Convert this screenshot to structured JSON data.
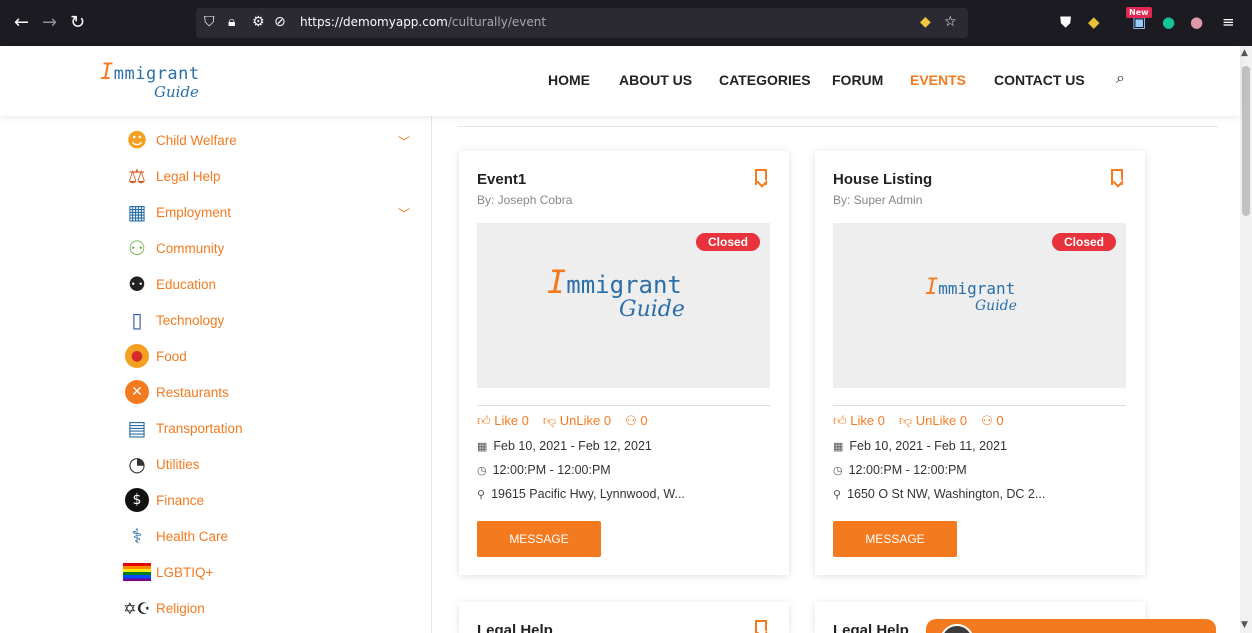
{
  "browser": {
    "url_host": "https://demomyapp.com",
    "url_path": "/culturally/event",
    "new_badge": "New"
  },
  "logo": {
    "initial": "I",
    "line1": "mmigrant",
    "line2": "Guide"
  },
  "nav": [
    {
      "label": "HOME",
      "active": false
    },
    {
      "label": "ABOUT US",
      "active": false
    },
    {
      "label": "CATEGORIES",
      "active": false
    },
    {
      "label": "FORUM",
      "active": false
    },
    {
      "label": "EVENTS",
      "active": true
    },
    {
      "label": "CONTACT US",
      "active": false
    }
  ],
  "sidebar": {
    "categories": [
      {
        "label": "Child Welfare",
        "icon": "child-icon",
        "expandable": true
      },
      {
        "label": "Legal Help",
        "icon": "scales-icon",
        "expandable": false
      },
      {
        "label": "Employment",
        "icon": "employment-icon",
        "expandable": true
      },
      {
        "label": "Community",
        "icon": "community-icon",
        "expandable": false
      },
      {
        "label": "Education",
        "icon": "education-icon",
        "expandable": false
      },
      {
        "label": "Technology",
        "icon": "technology-icon",
        "expandable": false
      },
      {
        "label": "Food",
        "icon": "food-icon",
        "expandable": false
      },
      {
        "label": "Restaurants",
        "icon": "restaurant-icon",
        "expandable": false
      },
      {
        "label": "Transportation",
        "icon": "bus-icon",
        "expandable": false
      },
      {
        "label": "Utilities",
        "icon": "gauge-icon",
        "expandable": false
      },
      {
        "label": "Finance",
        "icon": "money-icon",
        "expandable": false
      },
      {
        "label": "Health Care",
        "icon": "stethoscope-icon",
        "expandable": false
      },
      {
        "label": "LGBTIQ+",
        "icon": "rainbow-flag-icon",
        "expandable": false
      },
      {
        "label": "Religion",
        "icon": "religion-icon",
        "expandable": false
      }
    ]
  },
  "events": [
    {
      "title": "Event1",
      "by": "By: Joseph Cobra",
      "status": "Closed",
      "like": "Like 0",
      "unlike": "UnLike 0",
      "attendees": "0",
      "dates": "Feb 10, 2021 - Feb 12, 2021",
      "time": "12:00:PM - 12:00:PM",
      "address": "19615 Pacific Hwy, Lynnwood, W...",
      "button": "MESSAGE"
    },
    {
      "title": "House Listing",
      "by": "By: Super Admin",
      "status": "Closed",
      "like": "Like 0",
      "unlike": "UnLike 0",
      "attendees": "0",
      "dates": "Feb 10, 2021 - Feb 11, 2021",
      "time": "12:00:PM - 12:00:PM",
      "address": "1650 O St NW, Washington, DC 2...",
      "button": "MESSAGE"
    },
    {
      "title": "Legal Help"
    },
    {
      "title": "Legal Help"
    }
  ],
  "colors": {
    "accent": "#f47a20",
    "brand_blue": "#2a6fa8",
    "closed": "#e8323c"
  }
}
